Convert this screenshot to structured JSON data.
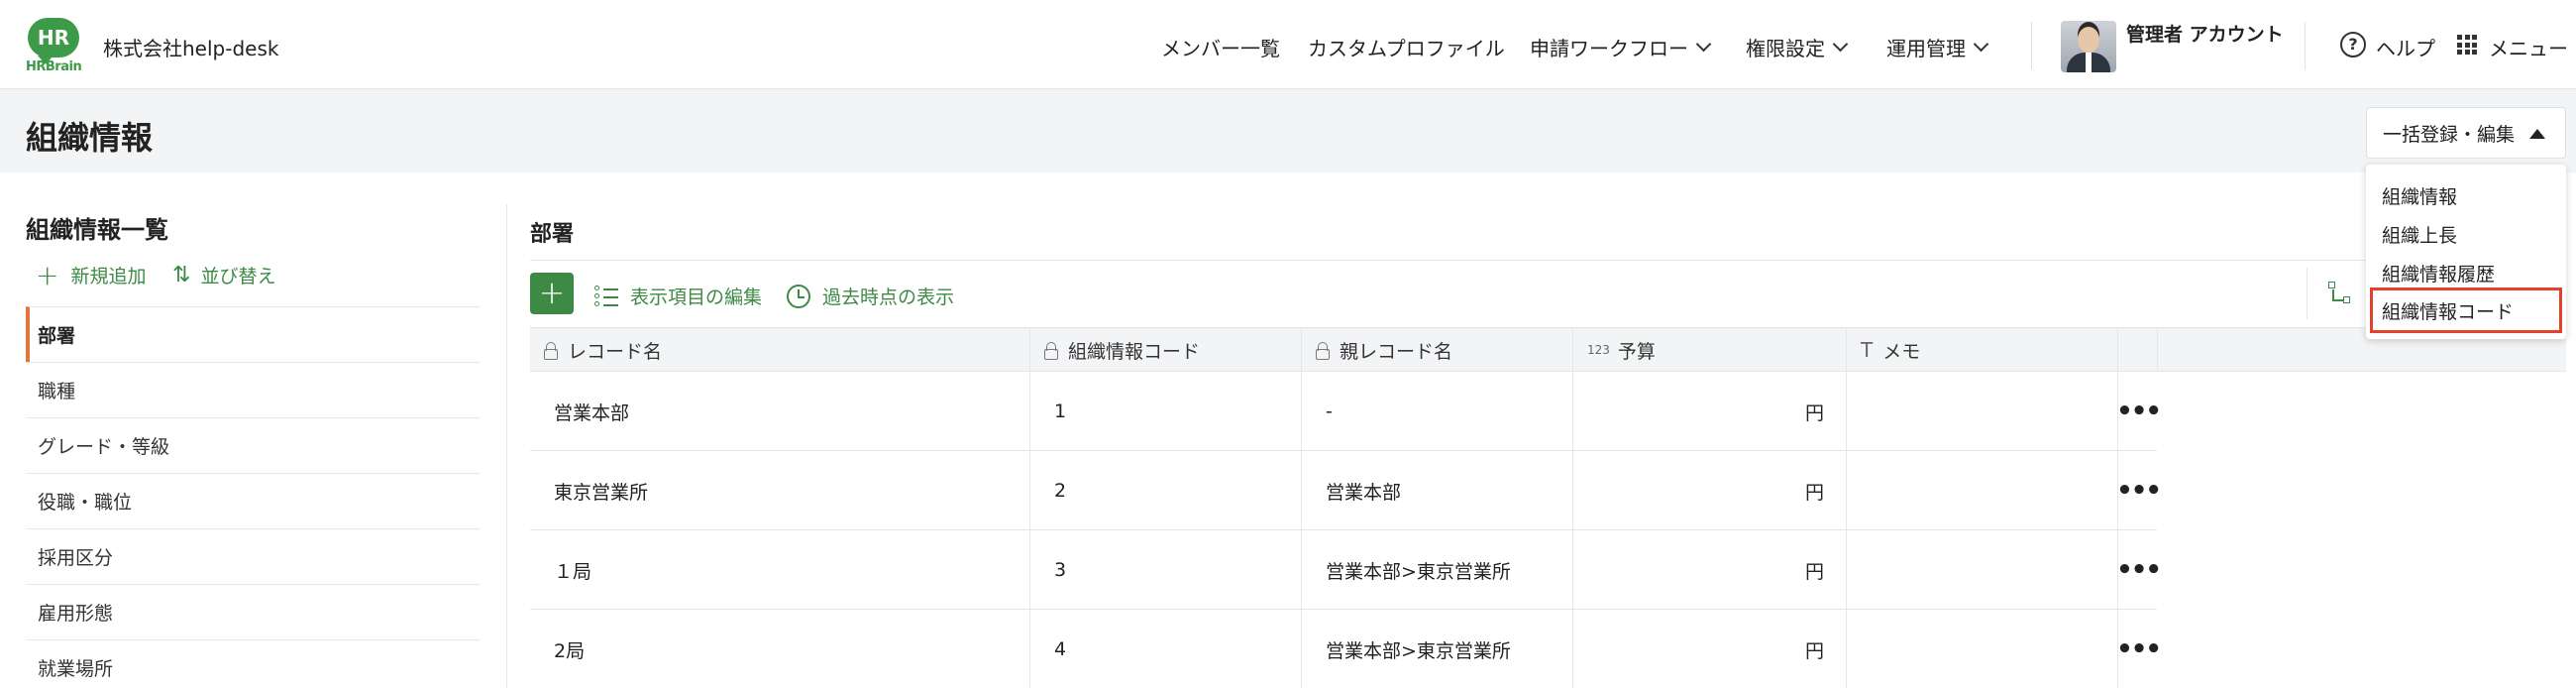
{
  "header": {
    "logo_mark": "HR",
    "logo_text": "HRBrain",
    "company_name": "株式会社help-desk",
    "nav": [
      {
        "label": "メンバー一覧",
        "has_dropdown": false
      },
      {
        "label": "カスタムプロファイル",
        "has_dropdown": false
      },
      {
        "label": "申請ワークフロー",
        "has_dropdown": true
      },
      {
        "label": "権限設定",
        "has_dropdown": true
      },
      {
        "label": "運用管理",
        "has_dropdown": true
      }
    ],
    "account_name": "管理者 アカウント",
    "help_label": "ヘルプ",
    "menu_label": "メニュー"
  },
  "page": {
    "title": "組織情報",
    "bulk_button_label": "一括登録・編集"
  },
  "dropdown": {
    "items": [
      "組織情報",
      "組織上長",
      "組織情報履歴",
      "組織情報コード"
    ],
    "highlighted_index": 3,
    "highlight_color": "#e0432a"
  },
  "left_panel": {
    "title": "組織情報一覧",
    "add_label": "新規追加",
    "sort_label": "並び替え",
    "items": [
      "部署",
      "職種",
      "グレード・等級",
      "役職・職位",
      "採用区分",
      "雇用形態",
      "就業場所"
    ],
    "active_index": 0
  },
  "main": {
    "section_title": "部署",
    "toolbar": {
      "edit_columns_label": "表示項目の編集",
      "past_view_label": "過去時点の表示"
    },
    "table": {
      "columns": [
        {
          "label": "レコード名",
          "icon": "lock-icon"
        },
        {
          "label": "組織情報コード",
          "icon": "lock-icon"
        },
        {
          "label": "親レコード名",
          "icon": "lock-icon"
        },
        {
          "label": "予算",
          "icon": "number-icon",
          "icon_text": "123"
        },
        {
          "label": "メモ",
          "icon": "text-icon",
          "icon_text": "T"
        }
      ],
      "rows": [
        {
          "name": "営業本部",
          "code": "1",
          "parent": "-",
          "budget": "円",
          "memo": ""
        },
        {
          "name": "東京営業所",
          "code": "2",
          "parent": "営業本部",
          "budget": "円",
          "memo": ""
        },
        {
          "name": "１局",
          "code": "3",
          "parent": "営業本部>東京営業所",
          "budget": "円",
          "memo": ""
        },
        {
          "name": "2局",
          "code": "4",
          "parent": "営業本部>東京営業所",
          "budget": "円",
          "memo": ""
        }
      ]
    }
  },
  "colors": {
    "brand_green": "#3d9a48",
    "action_green": "#3d8a45",
    "active_accent": "#e2753a"
  }
}
